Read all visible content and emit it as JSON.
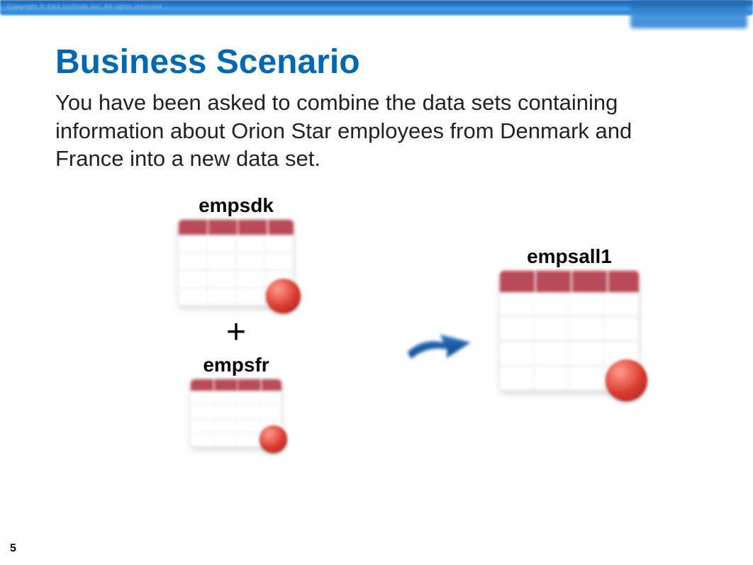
{
  "banner": {
    "copyright": "Copyright © SAS Institute Inc. All rights reserved."
  },
  "slide": {
    "title": "Business Scenario",
    "body": "You have been asked to combine the data sets containing information about Orion Star employees from Denmark and France into a new data set.",
    "page_number": "5"
  },
  "diagram": {
    "input_a": "empsdk",
    "operator": "+",
    "input_b": "empsfr",
    "output": "empsall1"
  }
}
